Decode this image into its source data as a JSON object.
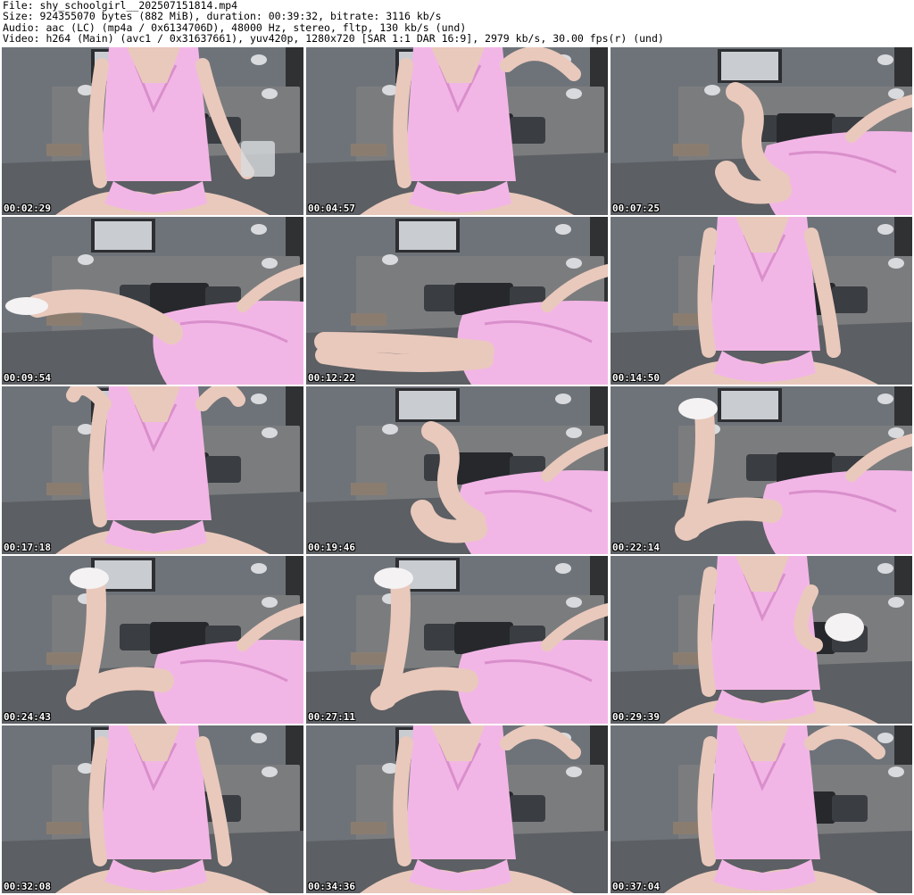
{
  "header": {
    "file_line": "File: shy_schoolgirl__202507151814.mp4",
    "size_line": "Size: 924355070 bytes (882 MiB), duration: 00:39:32, bitrate: 3116 kb/s",
    "audio_line": "Audio: aac (LC) (mp4a / 0x6134706D), 48000 Hz, stereo, fltp, 130 kb/s (und)",
    "video_line": "Video: h264 (Main) (avc1 / 0x31637661), yuv420p, 1280x720 [SAR 1:1 DAR 16:9], 2979 kb/s, 30.00 fps(r) (und)"
  },
  "thumbnails": [
    {
      "timestamp": "00:02:29",
      "pose": "sitting-cup"
    },
    {
      "timestamp": "00:04:57",
      "pose": "sitting-arm-up"
    },
    {
      "timestamp": "00:07:25",
      "pose": "lying-knee-up"
    },
    {
      "timestamp": "00:09:54",
      "pose": "lying-leg-left"
    },
    {
      "timestamp": "00:12:22",
      "pose": "lying-side"
    },
    {
      "timestamp": "00:14:50",
      "pose": "sitting"
    },
    {
      "timestamp": "00:17:18",
      "pose": "sitting-arms-up"
    },
    {
      "timestamp": "00:19:46",
      "pose": "lying-knee-up"
    },
    {
      "timestamp": "00:22:14",
      "pose": "lying-leg-raised"
    },
    {
      "timestamp": "00:24:43",
      "pose": "lying-leg-raised"
    },
    {
      "timestamp": "00:27:11",
      "pose": "lying-leg-raised"
    },
    {
      "timestamp": "00:29:39",
      "pose": "sitting-sock"
    },
    {
      "timestamp": "00:32:08",
      "pose": "sitting-arm-side"
    },
    {
      "timestamp": "00:34:36",
      "pose": "sitting-arm-up"
    },
    {
      "timestamp": "00:37:04",
      "pose": "sitting-arm-up"
    }
  ],
  "colors": {
    "wall": "#6e7379",
    "wall_dark": "#4a4d52",
    "headboard": "#7b7c7e",
    "bed": "#5c5f63",
    "pillow": "#26282c",
    "curtain": "#2f3133",
    "skin": "#e9c9bc",
    "dress": "#f2b6e6",
    "dress_shade": "#d98fcb",
    "sock": "#f4f2f3"
  }
}
